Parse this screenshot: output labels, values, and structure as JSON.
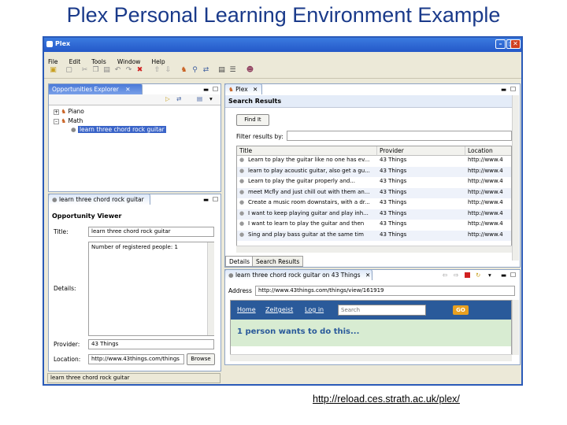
{
  "slide": {
    "title": "Plex Personal Learning Environment Example",
    "url": "http://reload.ces.strath.ac.uk/plex/"
  },
  "window": {
    "title": "Plex",
    "controls": [
      "minimize-icon",
      "maximize-icon",
      "close-icon"
    ]
  },
  "menu": [
    "File",
    "Edit",
    "Tools",
    "Window",
    "Help"
  ],
  "explorer": {
    "tab": "Opportunities Explorer",
    "tree": [
      "Piano",
      "Math",
      "learn three chord rock guitar"
    ]
  },
  "viewer": {
    "tab": "learn three chord rock guitar",
    "heading": "Opportunity Viewer",
    "title_label": "Title:",
    "title_value": "learn three chord rock guitar",
    "details_label": "Details:",
    "details_value": "Number of registered people: 1",
    "provider_label": "Provider:",
    "provider_value": "43 Things",
    "location_label": "Location:",
    "location_value": "http://www.43things.com/things",
    "browse_label": "Browse"
  },
  "search": {
    "tab": "Plex",
    "heading": "Search Results",
    "find_button": "Find It",
    "filter_label": "Filter results by:",
    "columns": [
      "Title",
      "Provider",
      "Location"
    ],
    "rows": [
      {
        "title": "Learn to play the guitar like no one has ev...",
        "provider": "43 Things",
        "location": "http://www.4"
      },
      {
        "title": "learn to play acoustic guitar, also get a gu...",
        "provider": "43 Things",
        "location": "http://www.4"
      },
      {
        "title": "Learn to play the guitar properly and...",
        "provider": "43 Things",
        "location": "http://www.4"
      },
      {
        "title": "meet Mcfly and just chill out with them an...",
        "provider": "43 Things",
        "location": "http://www.4"
      },
      {
        "title": "Create a music room downstairs, with a dr...",
        "provider": "43 Things",
        "location": "http://www.4"
      },
      {
        "title": "I want to keep playing guitar and play inh...",
        "provider": "43 Things",
        "location": "http://www.4"
      },
      {
        "title": "I want to learn to play the guitar and then",
        "provider": "43 Things",
        "location": "http://www.4"
      },
      {
        "title": "Sing and play bass guitar at the same tim",
        "provider": "43 Things",
        "location": "http://www.4"
      }
    ],
    "bottom_tabs": [
      "Details",
      "Search Results"
    ]
  },
  "browser": {
    "tab": "learn three chord rock guitar on 43 Things",
    "address_label": "Address",
    "address_value": "http://www.43things.com/things/view/161919",
    "nav": [
      "Home",
      "Zeitgeist",
      "Log in"
    ],
    "search_placeholder": "Search",
    "go_label": "GO",
    "message": "1 person wants to do this..."
  },
  "status": {
    "text": "learn three chord rock guitar"
  },
  "colors": {
    "site_header": "#2a5a9a",
    "site_banner": "#d8ecd2",
    "title_blue": "#1a3a8a",
    "go_button": "#e8a020"
  }
}
